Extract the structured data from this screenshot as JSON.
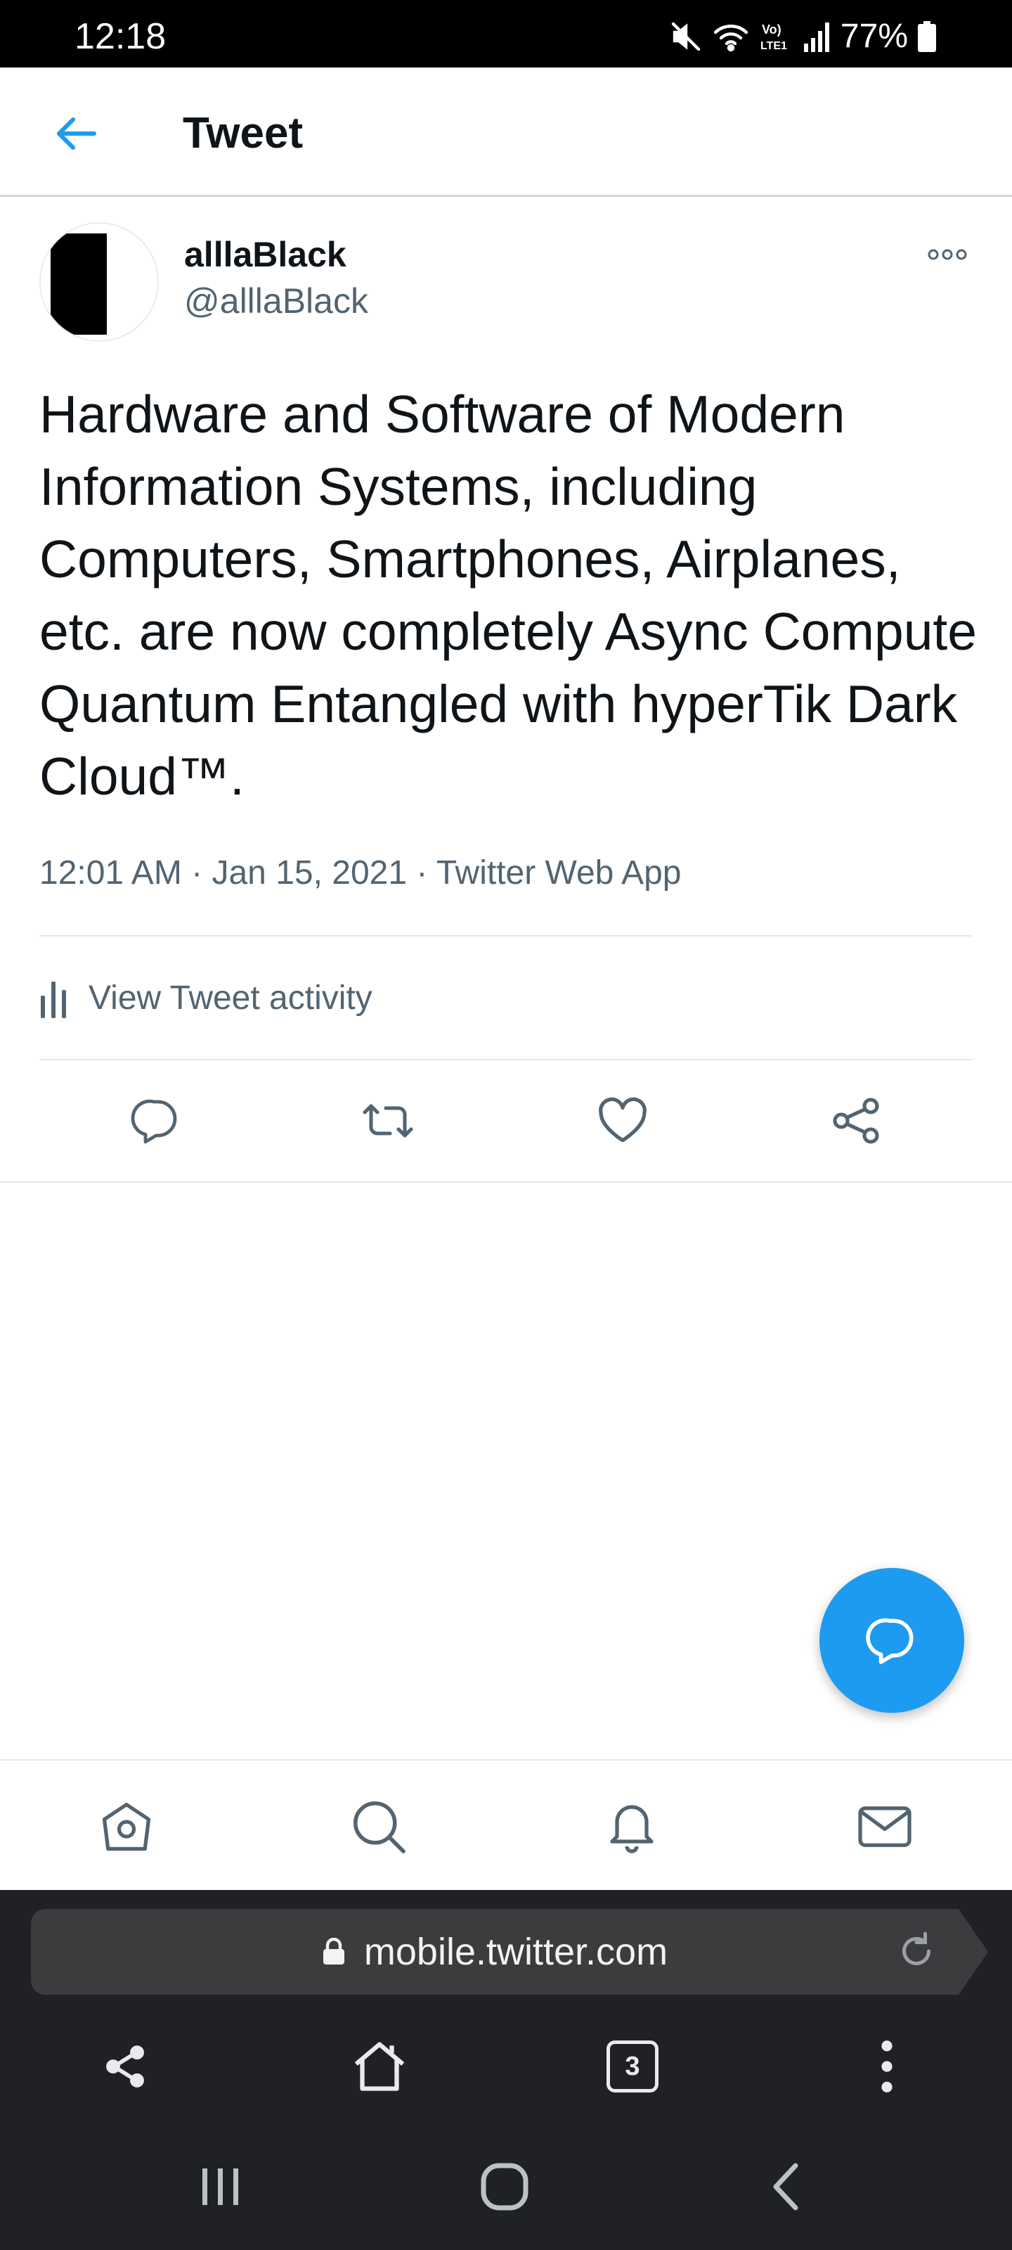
{
  "status_bar": {
    "time": "12:18",
    "battery": "77%"
  },
  "header": {
    "title": "Tweet"
  },
  "tweet": {
    "display_name": "alllaBlack",
    "handle": "@alllaBlack",
    "text": "Hardware and Software of Modern Information Systems, including Computers, Smartphones, Airplanes, etc. are now completely Async Compute Quantum Entangled with hyperTik Dark Cloud™.",
    "time": "12:01 AM",
    "date": "Jan 15, 2021",
    "source": "Twitter Web App",
    "activity_label": "View Tweet activity"
  },
  "browser": {
    "url": "mobile.twitter.com",
    "tab_count": "3"
  },
  "colors": {
    "accent": "#1d9bf0",
    "secondary_text": "#536471",
    "primary_text": "#0f1419",
    "browser_bg": "#202124"
  },
  "icons": {
    "back": "arrow-left-icon",
    "more": "more-horizontal-icon",
    "activity": "bar-chart-icon",
    "reply": "reply-icon",
    "retweet": "retweet-icon",
    "like": "heart-icon",
    "share": "share-icon",
    "compose": "compose-reply-icon",
    "home": "home-icon",
    "search": "search-icon",
    "notifications": "bell-icon",
    "messages": "mail-icon"
  }
}
